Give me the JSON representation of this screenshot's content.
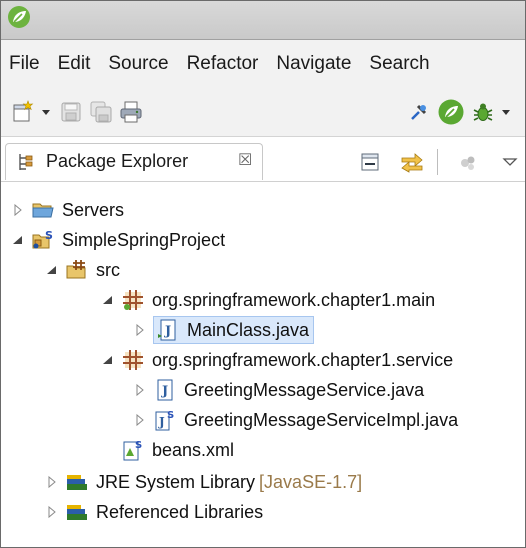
{
  "menu": [
    "File",
    "Edit",
    "Source",
    "Refactor",
    "Navigate",
    "Search"
  ],
  "view_tab": {
    "title": "Package Explorer",
    "close_glyph": "☒"
  },
  "icons": {
    "app": "spring-leaf-icon",
    "new": "new-wizard-icon",
    "save": "save-icon",
    "save_all": "save-all-icon",
    "print": "print-icon",
    "pin": "pin-icon",
    "spring": "spring-boot-icon",
    "debug": "debug-icon",
    "dropdown": "chevron-down-icon",
    "collapse_all": "collapse-all-icon",
    "link_editor": "link-with-editor-icon",
    "filter": "filter-icon",
    "view_menu": "view-menu-icon"
  },
  "tree": [
    {
      "label": "Servers",
      "expanded": false,
      "icon": "folder-icon"
    },
    {
      "label": "SimpleSpringProject",
      "expanded": true,
      "icon": "spring-project-icon"
    },
    {
      "label": "src",
      "expanded": true,
      "icon": "source-folder-icon"
    },
    {
      "label": "org.springframework.chapter1.main",
      "expanded": true,
      "icon": "package-icon"
    },
    {
      "label": "MainClass.java",
      "expanded": false,
      "icon": "java-file-icon"
    },
    {
      "label": "org.springframework.chapter1.service",
      "expanded": true,
      "icon": "package-icon"
    },
    {
      "label": "GreetingMessageService.java",
      "expanded": false,
      "icon": "java-interface-icon"
    },
    {
      "label": "GreetingMessageServiceImpl.java",
      "expanded": false,
      "icon": "spring-java-file-icon"
    },
    {
      "label": "beans.xml",
      "icon": "spring-xml-icon"
    },
    {
      "label": "JRE System Library",
      "decoration": "[JavaSE-1.7]",
      "expanded": false,
      "icon": "library-icon"
    },
    {
      "label": "Referenced Libraries",
      "expanded": false,
      "icon": "library-icon"
    }
  ],
  "colors": {
    "selection": "#d9e8fb",
    "package": "#a0522d",
    "spring_green": "#6db33f"
  }
}
